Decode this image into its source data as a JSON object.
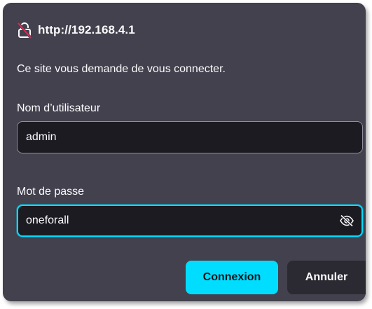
{
  "dialog": {
    "url": "http://192.168.4.1",
    "prompt": "Ce site vous demande de vous connecter.",
    "username": {
      "label": "Nom d’utilisateur",
      "value": "admin"
    },
    "password": {
      "label": "Mot de passe",
      "value": "oneforall"
    },
    "buttons": {
      "connect_label": "Connexion",
      "cancel_label": "Annuler"
    }
  },
  "icons": {
    "insecure_lock": "insecure-lock-icon",
    "toggle_password": "eye-slash-icon"
  },
  "colors": {
    "dialog_bg": "#42414d",
    "input_bg": "#1c1b22",
    "accent": "#00ddff",
    "secondary_button_bg": "#2b2a33",
    "insecure_slash": "#e22850"
  }
}
